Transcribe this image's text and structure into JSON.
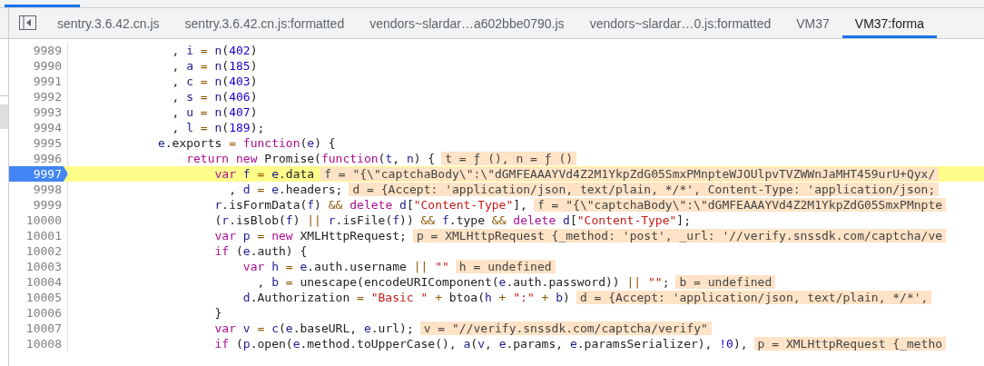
{
  "tabs": [
    {
      "label": "sentry.3.6.42.cn.js",
      "selected": false
    },
    {
      "label": "sentry.3.6.42.cn.js:formatted",
      "selected": false
    },
    {
      "label": "vendors~slardar…a602bbe0790.js",
      "selected": false
    },
    {
      "label": "vendors~slardar…0.js:formatted",
      "selected": false
    },
    {
      "label": "VM37",
      "selected": false
    },
    {
      "label": "VM37:forma",
      "selected": true
    }
  ],
  "lines": [
    {
      "number": "9989",
      "paused": false,
      "tokens": [
        {
          "kind": "plain",
          "text": "              , "
        },
        {
          "kind": "var",
          "text": "i"
        },
        {
          "kind": "op",
          "text": " = "
        },
        {
          "kind": "var",
          "text": "n"
        },
        {
          "kind": "plain",
          "text": "("
        },
        {
          "kind": "num",
          "text": "402"
        },
        {
          "kind": "plain",
          "text": ")"
        }
      ]
    },
    {
      "number": "9990",
      "paused": false,
      "tokens": [
        {
          "kind": "plain",
          "text": "              , "
        },
        {
          "kind": "var",
          "text": "a"
        },
        {
          "kind": "op",
          "text": " = "
        },
        {
          "kind": "var",
          "text": "n"
        },
        {
          "kind": "plain",
          "text": "("
        },
        {
          "kind": "num",
          "text": "185"
        },
        {
          "kind": "plain",
          "text": ")"
        }
      ]
    },
    {
      "number": "9991",
      "paused": false,
      "tokens": [
        {
          "kind": "plain",
          "text": "              , "
        },
        {
          "kind": "var",
          "text": "c"
        },
        {
          "kind": "op",
          "text": " = "
        },
        {
          "kind": "var",
          "text": "n"
        },
        {
          "kind": "plain",
          "text": "("
        },
        {
          "kind": "num",
          "text": "403"
        },
        {
          "kind": "plain",
          "text": ")"
        }
      ]
    },
    {
      "number": "9992",
      "paused": false,
      "tokens": [
        {
          "kind": "plain",
          "text": "              , "
        },
        {
          "kind": "var",
          "text": "s"
        },
        {
          "kind": "op",
          "text": " = "
        },
        {
          "kind": "var",
          "text": "n"
        },
        {
          "kind": "plain",
          "text": "("
        },
        {
          "kind": "num",
          "text": "406"
        },
        {
          "kind": "plain",
          "text": ")"
        }
      ]
    },
    {
      "number": "9993",
      "paused": false,
      "tokens": [
        {
          "kind": "plain",
          "text": "              , "
        },
        {
          "kind": "var",
          "text": "u"
        },
        {
          "kind": "op",
          "text": " = "
        },
        {
          "kind": "var",
          "text": "n"
        },
        {
          "kind": "plain",
          "text": "("
        },
        {
          "kind": "num",
          "text": "407"
        },
        {
          "kind": "plain",
          "text": ")"
        }
      ]
    },
    {
      "number": "9994",
      "paused": false,
      "tokens": [
        {
          "kind": "plain",
          "text": "              , "
        },
        {
          "kind": "var",
          "text": "l"
        },
        {
          "kind": "op",
          "text": " = "
        },
        {
          "kind": "var",
          "text": "n"
        },
        {
          "kind": "plain",
          "text": "("
        },
        {
          "kind": "num",
          "text": "189"
        },
        {
          "kind": "plain",
          "text": ");"
        }
      ]
    },
    {
      "number": "9995",
      "paused": false,
      "tokens": [
        {
          "kind": "var",
          "text": "            e"
        },
        {
          "kind": "plain",
          "text": ".exports "
        },
        {
          "kind": "op",
          "text": "= "
        },
        {
          "kind": "kw",
          "text": "function"
        },
        {
          "kind": "plain",
          "text": "("
        },
        {
          "kind": "var",
          "text": "e"
        },
        {
          "kind": "plain",
          "text": ") {"
        }
      ]
    },
    {
      "number": "9996",
      "paused": false,
      "tokens": [
        {
          "kind": "kw",
          "text": "                return "
        },
        {
          "kind": "kw",
          "text": "new"
        },
        {
          "kind": "plain",
          "text": " Promise("
        },
        {
          "kind": "kw",
          "text": "function"
        },
        {
          "kind": "plain",
          "text": "("
        },
        {
          "kind": "var",
          "text": "t"
        },
        {
          "kind": "plain",
          "text": ", "
        },
        {
          "kind": "var",
          "text": "n"
        },
        {
          "kind": "plain",
          "text": ") {"
        }
      ],
      "annotation": "t = ƒ (), n = ƒ ()"
    },
    {
      "number": "9997",
      "paused": true,
      "tokens": [
        {
          "kind": "kw",
          "text": "                    var "
        },
        {
          "kind": "var",
          "text": "f"
        },
        {
          "kind": "op",
          "text": " = "
        },
        {
          "kind": "var",
          "text": "e"
        },
        {
          "kind": "plain",
          "text": ".data"
        }
      ],
      "annotation": "f = \"{\\\"captchaBody\\\":\\\"dGMFEAAAYVd4Z2M1YkpZdG05SmxPMnpteWJOUlpvTVZWWnJaMHT459urU+Qyx/"
    },
    {
      "number": "9998",
      "paused": false,
      "tokens": [
        {
          "kind": "plain",
          "text": "                      , "
        },
        {
          "kind": "var",
          "text": "d"
        },
        {
          "kind": "op",
          "text": " = "
        },
        {
          "kind": "var",
          "text": "e"
        },
        {
          "kind": "plain",
          "text": ".headers;"
        }
      ],
      "annotation": "d = {Accept: 'application/json, text/plain, */*', Content-Type: 'application/json;"
    },
    {
      "number": "9999",
      "paused": false,
      "tokens": [
        {
          "kind": "var",
          "text": "                    r"
        },
        {
          "kind": "plain",
          "text": ".isFormData("
        },
        {
          "kind": "var",
          "text": "f"
        },
        {
          "kind": "plain",
          "text": ") "
        },
        {
          "kind": "op",
          "text": "&& "
        },
        {
          "kind": "kw",
          "text": "delete "
        },
        {
          "kind": "var",
          "text": "d"
        },
        {
          "kind": "plain",
          "text": "["
        },
        {
          "kind": "str",
          "text": "\"Content-Type\""
        },
        {
          "kind": "plain",
          "text": "],"
        }
      ],
      "annotation": "f = \"{\\\"captchaBody\\\":\\\"dGMFEAAAYVd4Z2M1YkpZdG05SmxPMnpte"
    },
    {
      "number": "10000",
      "paused": false,
      "tokens": [
        {
          "kind": "plain",
          "text": "                    ("
        },
        {
          "kind": "var",
          "text": "r"
        },
        {
          "kind": "plain",
          "text": ".isBlob("
        },
        {
          "kind": "var",
          "text": "f"
        },
        {
          "kind": "plain",
          "text": ") "
        },
        {
          "kind": "op",
          "text": "|| "
        },
        {
          "kind": "var",
          "text": "r"
        },
        {
          "kind": "plain",
          "text": ".isFile("
        },
        {
          "kind": "var",
          "text": "f"
        },
        {
          "kind": "plain",
          "text": ")) "
        },
        {
          "kind": "op",
          "text": "&& "
        },
        {
          "kind": "var",
          "text": "f"
        },
        {
          "kind": "plain",
          "text": ".type "
        },
        {
          "kind": "op",
          "text": "&& "
        },
        {
          "kind": "kw",
          "text": "delete "
        },
        {
          "kind": "var",
          "text": "d"
        },
        {
          "kind": "plain",
          "text": "["
        },
        {
          "kind": "str",
          "text": "\"Content-Type\""
        },
        {
          "kind": "plain",
          "text": "];"
        }
      ]
    },
    {
      "number": "10001",
      "paused": false,
      "tokens": [
        {
          "kind": "kw",
          "text": "                    var "
        },
        {
          "kind": "var",
          "text": "p"
        },
        {
          "kind": "op",
          "text": " = "
        },
        {
          "kind": "kw",
          "text": "new"
        },
        {
          "kind": "plain",
          "text": " XMLHttpRequest;"
        }
      ],
      "annotation": "p = XMLHttpRequest {_method: 'post', _url: '//verify.snssdk.com/captcha/ve"
    },
    {
      "number": "10002",
      "paused": false,
      "tokens": [
        {
          "kind": "kw",
          "text": "                    if"
        },
        {
          "kind": "plain",
          "text": " ("
        },
        {
          "kind": "var",
          "text": "e"
        },
        {
          "kind": "plain",
          "text": ".auth) {"
        }
      ]
    },
    {
      "number": "10003",
      "paused": false,
      "tokens": [
        {
          "kind": "kw",
          "text": "                        var "
        },
        {
          "kind": "var",
          "text": "h"
        },
        {
          "kind": "op",
          "text": " = "
        },
        {
          "kind": "var",
          "text": "e"
        },
        {
          "kind": "plain",
          "text": ".auth.username "
        },
        {
          "kind": "op",
          "text": "|| "
        },
        {
          "kind": "str",
          "text": "\"\""
        }
      ],
      "annotation": "h = undefined"
    },
    {
      "number": "10004",
      "paused": false,
      "tokens": [
        {
          "kind": "plain",
          "text": "                          , "
        },
        {
          "kind": "var",
          "text": "b"
        },
        {
          "kind": "op",
          "text": " = "
        },
        {
          "kind": "plain",
          "text": "unescape(encodeURIComponent("
        },
        {
          "kind": "var",
          "text": "e"
        },
        {
          "kind": "plain",
          "text": ".auth.password)) "
        },
        {
          "kind": "op",
          "text": "|| "
        },
        {
          "kind": "str",
          "text": "\"\""
        },
        {
          "kind": "plain",
          "text": ";"
        }
      ],
      "annotation": "b = undefined"
    },
    {
      "number": "10005",
      "paused": false,
      "tokens": [
        {
          "kind": "var",
          "text": "                        d"
        },
        {
          "kind": "plain",
          "text": ".Authorization "
        },
        {
          "kind": "op",
          "text": "= "
        },
        {
          "kind": "str",
          "text": "\"Basic \""
        },
        {
          "kind": "op",
          "text": " + "
        },
        {
          "kind": "plain",
          "text": "btoa("
        },
        {
          "kind": "var",
          "text": "h"
        },
        {
          "kind": "op",
          "text": " + "
        },
        {
          "kind": "str",
          "text": "\":\""
        },
        {
          "kind": "op",
          "text": " + "
        },
        {
          "kind": "var",
          "text": "b"
        },
        {
          "kind": "plain",
          "text": ")"
        }
      ],
      "annotation": "d = {Accept: 'application/json, text/plain, */*',"
    },
    {
      "number": "10006",
      "paused": false,
      "tokens": [
        {
          "kind": "plain",
          "text": "                    }"
        }
      ]
    },
    {
      "number": "10007",
      "paused": false,
      "tokens": [
        {
          "kind": "kw",
          "text": "                    var "
        },
        {
          "kind": "var",
          "text": "v"
        },
        {
          "kind": "op",
          "text": " = "
        },
        {
          "kind": "var",
          "text": "c"
        },
        {
          "kind": "plain",
          "text": "("
        },
        {
          "kind": "var",
          "text": "e"
        },
        {
          "kind": "plain",
          "text": ".baseURL, "
        },
        {
          "kind": "var",
          "text": "e"
        },
        {
          "kind": "plain",
          "text": ".url);"
        }
      ],
      "annotation": "v = \"//verify.snssdk.com/captcha/verify\""
    },
    {
      "number": "10008",
      "paused": false,
      "tokens": [
        {
          "kind": "kw",
          "text": "                    if"
        },
        {
          "kind": "plain",
          "text": " ("
        },
        {
          "kind": "var",
          "text": "p"
        },
        {
          "kind": "plain",
          "text": ".open("
        },
        {
          "kind": "var",
          "text": "e"
        },
        {
          "kind": "plain",
          "text": ".method.toUpperCase(), "
        },
        {
          "kind": "var",
          "text": "a"
        },
        {
          "kind": "plain",
          "text": "("
        },
        {
          "kind": "var",
          "text": "v"
        },
        {
          "kind": "plain",
          "text": ", "
        },
        {
          "kind": "var",
          "text": "e"
        },
        {
          "kind": "plain",
          "text": ".params, "
        },
        {
          "kind": "var",
          "text": "e"
        },
        {
          "kind": "plain",
          "text": ".paramsSerializer), "
        },
        {
          "kind": "num",
          "text": "!0"
        },
        {
          "kind": "plain",
          "text": "),"
        }
      ],
      "annotation": "p = XMLHttpRequest {_metho"
    }
  ]
}
